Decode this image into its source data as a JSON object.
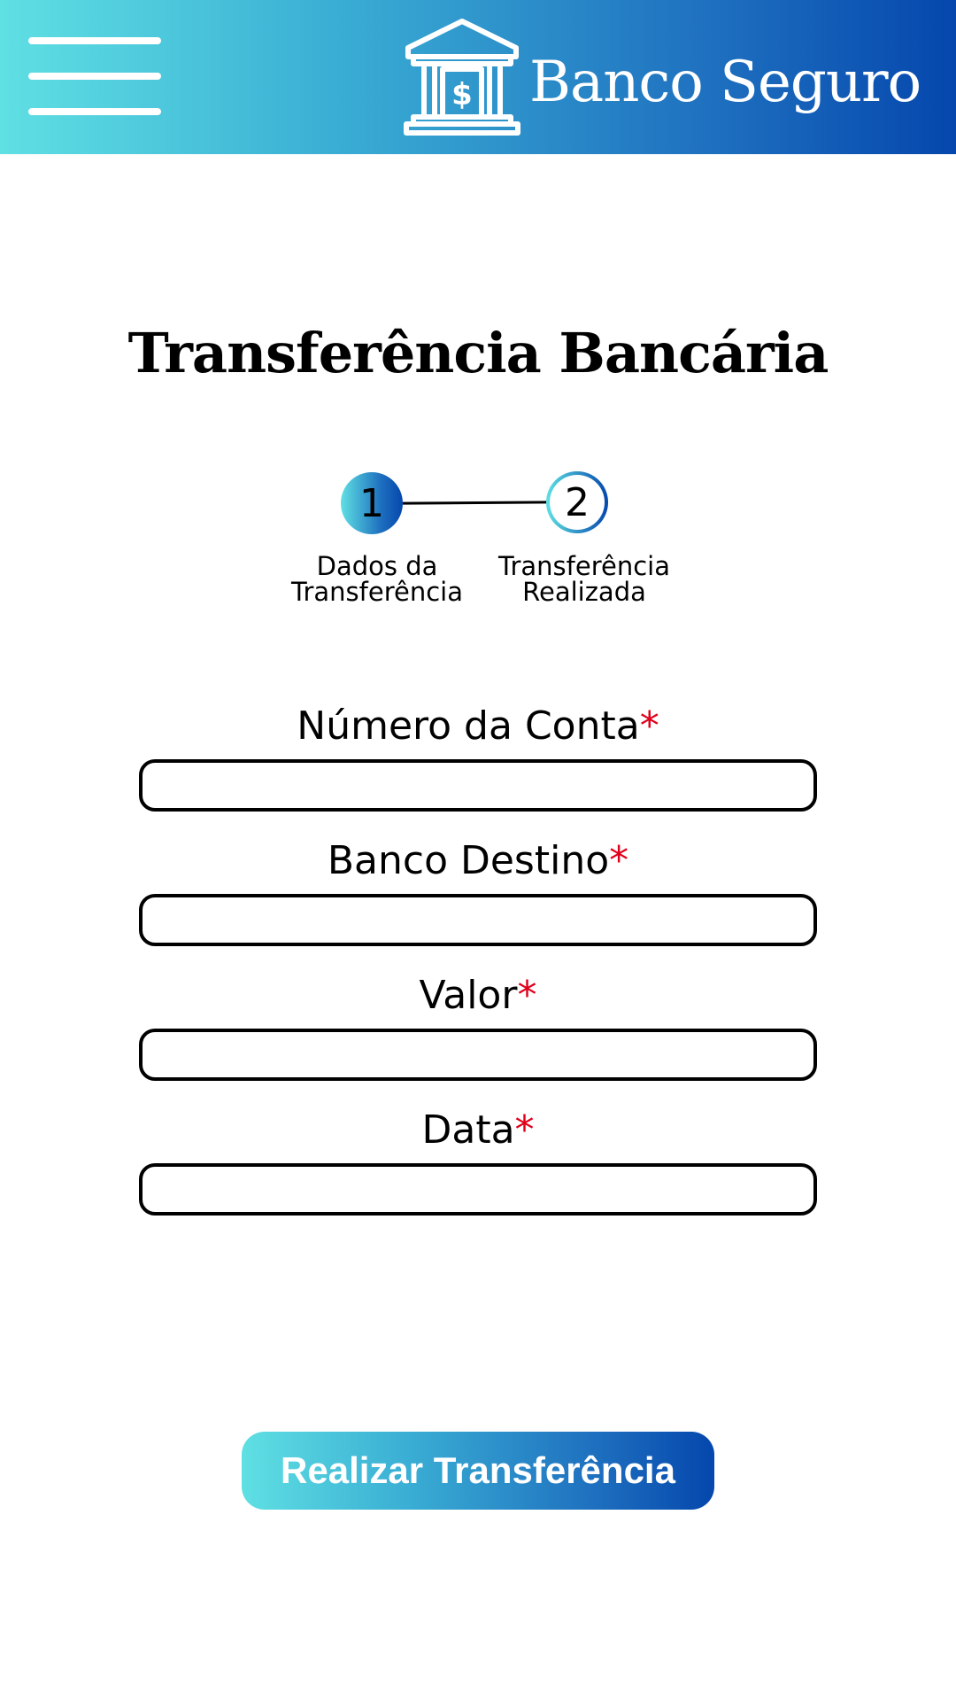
{
  "header": {
    "brand_name": "Banco Seguro",
    "menu_icon": "hamburger-menu-icon",
    "logo_icon": "bank-building-dollar-icon",
    "gradient_start": "#5fe0e3",
    "gradient_end": "#0547ad"
  },
  "main": {
    "title": "Transferência Bancária"
  },
  "stepper": {
    "current_step": 1,
    "steps": [
      {
        "number": "1",
        "label": "Dados da\nTransferência"
      },
      {
        "number": "2",
        "label": "Transferência\nRealizada"
      }
    ]
  },
  "form": {
    "required_marker": "*",
    "required_color": "#e0001b",
    "fields": [
      {
        "label": "Número da Conta",
        "value": "",
        "required": true
      },
      {
        "label": "Banco Destino",
        "value": "",
        "required": true
      },
      {
        "label": "Valor",
        "value": "",
        "required": true
      },
      {
        "label": "Data",
        "value": "",
        "required": true
      }
    ],
    "submit_label": "Realizar Transferência"
  }
}
